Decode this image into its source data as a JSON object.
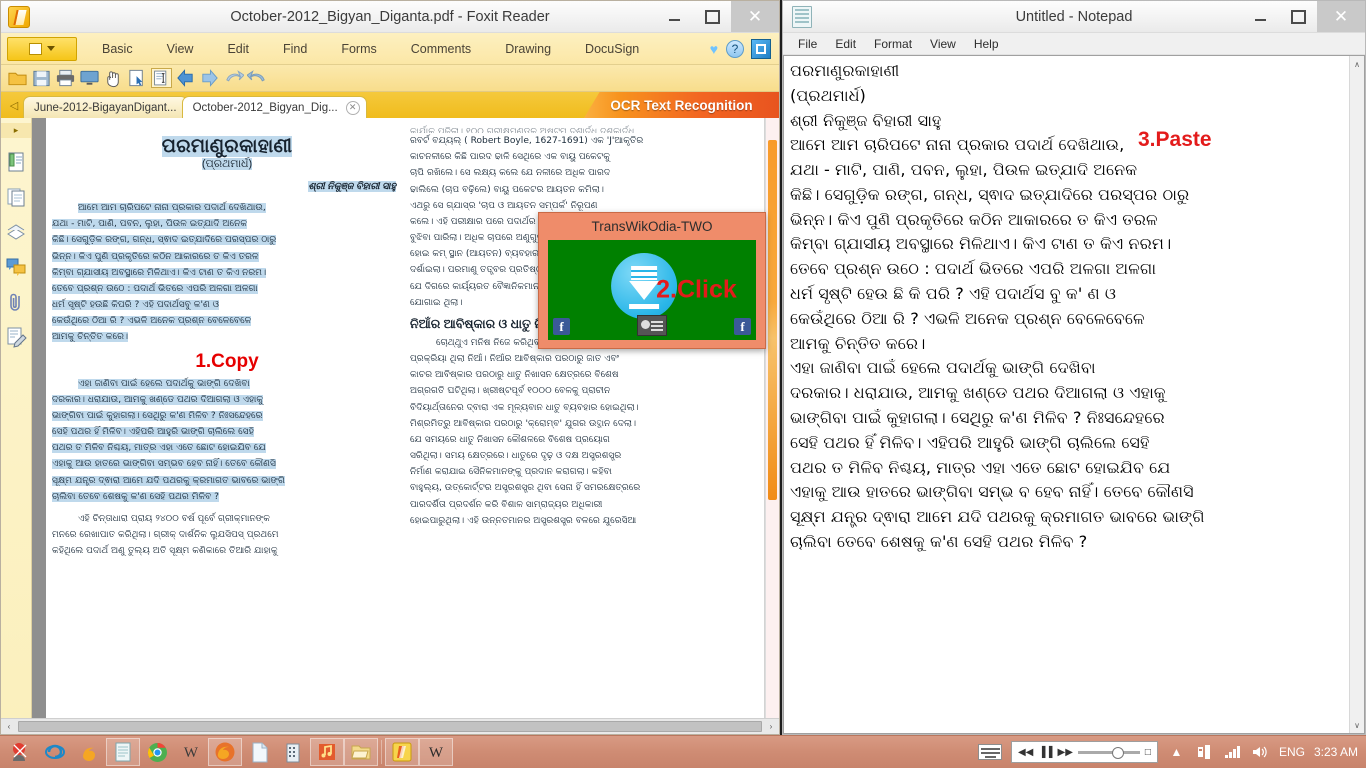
{
  "foxit": {
    "title": "October-2012_Bigyan_Diganta.pdf - Foxit Reader",
    "app_icon": "foxit-logo-icon",
    "window_buttons": {
      "minimize": "–",
      "maximize": "□",
      "close": "✕"
    },
    "file_button_label": "",
    "menus": [
      "Basic",
      "View",
      "Edit",
      "Find",
      "Forms",
      "Comments",
      "Drawing",
      "DocuSign"
    ],
    "heart": "♥",
    "help": "?",
    "toolbar_icons": [
      "open-folder-icon",
      "save-icon",
      "print-icon",
      "snapshot-icon",
      "hand-tool-icon",
      "select-object-icon",
      "text-select-icon",
      "previous-page-icon",
      "next-page-icon",
      "undo-icon",
      "redo-icon"
    ],
    "sidebar_icons": [
      "expand-panel-arrow-icon",
      "bookmarks-icon",
      "pages-thumbnail-icon",
      "layers-icon",
      "comments-icon",
      "attachments-icon",
      "signature-icon"
    ],
    "tabs": [
      {
        "label": "June-2012-BigayanDigant...",
        "active": false
      },
      {
        "label": "October-2012_Bigyan_Dig...",
        "active": true,
        "close": "✕"
      }
    ],
    "tab_nav": {
      "left": "◁",
      "right": "▷",
      "dropdown": "▼"
    },
    "ocr_button_label": "OCR Text Recognition",
    "copy_annotation": "1.Copy",
    "scroll": {
      "up": "∧",
      "down": "∨",
      "left": "‹",
      "right": "›"
    }
  },
  "pdf": {
    "title": "ପରମାଣୁରକାହାଣୀ",
    "subtitle": "(ପ୍ରଥମାର୍ଧ)",
    "author": "ଶ୍ରୀ ନିକୁଞ୍ଜ ବିହାରୀ ସାହୁ",
    "left_column_highlighted": [
      "ଆମେ ଆମ ଚାରିପଟେ ନାନା ପ୍ରକାର ପଦାର୍ଥ ଦେଖିଥାଉ,",
      "ଯଥା - ମାଟି, ପାଣି, ପବନ, ଲୁହା, ପିଉଳ ଇତ୍ଯାଦି ଅନେକ",
      "କିଛି। ସେଗୁଡ଼ିକ ରଙ୍ଗ, ଗନ୍ଧ, ସ୍ଵାଦ ଇତ୍ଯାଦିରେ ପରସ୍ପର ଠାରୁ",
      "ଭିନ୍ନ। କିଏ ପୁଣି ପ୍ରକୃତିରେ କଠିନ ଆକାରରେ ତ କିଏ ତରଳ",
      "କିମ୍ବା ଗ୍ଯାସୀୟ ଅବସ୍ଥାରେ ମିଳିଥାଏ। କିଏ ଟାଣ ତ କିଏ ନରମ।",
      "ତେବେ ପ୍ରଶ୍ନ ଉଠେ : ପଦାର୍ଥ ଭିତରେ ଏପରି ଅଳଗା ଅଳଗା",
      "ଧର୍ମ ସୃଷ୍ଟି ହଉଛି କିପରି ? ଏହି ପଦାର୍ଥସବୁ କ'ଣ ଓ",
      "କେଉଁଥିରେ ଠିଆ ରି ? ଏଭଳି ଅନେକ ପ୍ରଶ୍ନ ବେଳେବେଳେ",
      "ଆମକୁ ଚିନ୍ତିତ କରେ।"
    ],
    "left_column_block2": [
      "ଏହା ଜାଣିବା ପାଇଁ ହେଲେ ପଦାର୍ଥକୁ ଭାଙ୍ଗି ଦେଖିବା",
      "ଦରକାର। ଧରାଯାଉ, ଆମକୁ ଖଣ୍ଡେ ପଥର ଦିଆଗଲା ଓ ଏହାକୁ",
      "ଭାଙ୍ଗିବା ପାଇଁ କୁହାଗଲା। ସେଥିରୁ କ'ଣ ମିଳିବ ? ନିଃସନ୍ଦେହରେ",
      "ସେହି ପଥର ହିଁ ମିଳିବ। ଏହିପରି ଆହୁରି ଭାଙ୍ଗି ଚାଲିଲେ ସେହି",
      "ପଥର ତ ମିଳିବ ନିଶ୍ଚୟ, ମାତ୍ର ଏହା ଏତେ ଛୋଟ ହୋଇଯିବ ଯେ",
      "ଏହାକୁ ଆଉ ହାତରେ ଭାଙ୍ଗିବା ସମ୍ଭବ ହେବ ନାହିଁ। ତେବେ କୌଣସି",
      "ସୂକ୍ଷ୍ମ ଯନ୍ତ୍ର ଦ୍ଵାରା ଆମେ ଯଦି ପଥରକୁ କ୍ରମାଗତ ଭାବରେ ଭାଙ୍ଗି",
      "ଚାଲିବା ତେବେ ଶେଷକୁ କ'ଣ ସେହି ପଥର ମିଳିବ ?"
    ],
    "left_column_block3": [
      "ଏହି ଚିନ୍ତାଧାରା ପ୍ରାୟ ୨୪୦୦ ବର୍ଷ ପୂର୍ବେ ଗ୍ରୀକ୍ମାନଙ୍କ",
      "ମନରେ ରେଖାପାତ କରିଥିଲା। ଗ୍ରୀକ୍ ଦାର୍ଶନିକ ଲ୍ଯୁସିପସ୍ ପ୍ରଥମେ",
      "କହିଥିଲେ ପଦାର୍ଥ ଅଣୁ ତୁଲ୍ୟ ଅତି ସୂକ୍ଷ୍ମ କଣିକାରେ ତିଆରି ଯାହାକୁ"
    ],
    "right_column": [
      "ରବର୍ଟ ବଯ୍ୟଲ୍ ( Robert Boyle, 1627-1691) ଏକ 'J'ଆକୃତିର",
      "କାଚନଳୀରେ କିଛି ପାରଦ ଢାଳି ସେଥିରେ ଏକ ବାୟୁ ପକେଟକୁ",
      "ଚାପି ରଖିଲେ। ସେ ଲକ୍ଷ୍ୟ କଲେ ଯେ ନଳୀରେ ଅଧିକ ପାରଦ",
      "ଢାଲିଲେ (ଚାପ ବଢ଼ିଲେ) ବାୟୁ ପକେଟର ଆୟତନ କମିଲା।",
      "ଏଥରୁ ସେ ଗ୍ଯାସ୍ର 'ଚାପ ଓ ଆୟତନ ସମ୍ପର୍କ' ନିରୂପଣ",
      "କଲେ। ଏହି ପରୀକ୍ଷାର ପରେ ପଦାର୍ଥର ଅଣୁ ଧାରଣାକୁ",
      "ବୁଝିବା ପାରିଲା। ଅଧିକ ଚାପରେ ଅଣୁଗୁଡ଼ିକ ନିକଟ",
      "ହୋଇ କମ୍ ସ୍ଥାନ (ଆୟତନ) ବ୍ୟବହାର କରୁଥିବା",
      "ଦର୍ଶାଇଲା। ପରମାଣୁ ତତ୍ତ୍ବର ପ୍ରତିଷ୍ଠା ଏହା",
      "ଯେ ଦିଗରେ କାର୍ୟ୍ୟରତ ବୈଜ୍ଞାନିକମାନଙ୍କୁ ଯଥେଷ୍ଟ ପ୍ରେରଣା",
      "ଯୋଗାଇ ଥିଲା।"
    ],
    "right_heading": "ନିଆଁର ଆବିଷ୍କାର ଓ ଧାତୁ ନିଖାସନ",
    "right_column2": [
      "ଚୋଥ୍ଥୁଏ ମନିଷ ନିଜେ କରିଥିବା ସର୍ବପ୍ରଥମ ରାସାୟନିକ",
      "ପ୍ରକ୍ରିୟା ଥିଲା ନିଆଁ। ନିଆଁର ଆବିଷ୍କାର ପରଠାରୁ ଜାତ ଏବଂ",
      "କାଚର ଆବିଷ୍କାର ପରଠାରୁ ଧାତୁ ନିଖାସନ କ୍ଷେତ୍ରରେ ବିଶେଷ",
      "ଅଗ୍ରଗତି ଘଟିଥିଲା। ଖ୍ରୀଷ୍ଟପୂର୍ବ ୧୦୦୦ ବେଳକୁ ପ୍ରାଚୀନ",
      "ବିଦିୟାର୍ଥ୍ତାନେର ଦ୍ବାରା ଏକ ମୂଳ୍ୟବାନ ଧାତୁ ବ୍ୟବହାର ହୋଇଥିଲା।",
      "ମିଶ୍ରମିତ୍ରୁ ଆବିଷ୍କାର ପରଠାରୁ 'କ୍ରୋମ୍ବ' ଯୁଗର ଉତ୍ଥାନ ଦେଲା।",
      "ଯେ ସମୟରେ ଧାତୁ ନିଖାସନ କୌଶଳରେ ବିଶେଷ ପ୍ରୟୋଗ",
      "ସରିଥିଲା। ସମୟ କ୍ଷେତ୍ରରେ। ଧାତୁରେ ଦୃଢ଼ ଓ ଦକ୍ଷ ଅସ୍ତ୍ରଶସ୍ତ୍ର",
      "ନିର୍ମାଣ କରାଯାଇ ସୈନିକମାନଙ୍କୁ ପ୍ରଦାନ କରାଗଲା। କହିବା",
      "ବାହୁଲ୍ୟ, ଉତ୍କୋର୍ଟ୍ଟର ଅସ୍ତ୍ରଶସ୍ତ୍ର ଥିବା ସେନା ହିଁ ସମରକ୍ଷେତ୍ରରେ",
      "ପାରଦର୍ଶିତା ପ୍ରଦର୍ଶନ କରି ବିଶାଳ ସାମ୍ରାଜ୍ୟର ଅଧିକାରୀ",
      "ହୋଇପାରୁଥିଲା। ଏହି ଉନ୍ନତମାନର ଅସ୍ତ୍ରଶସ୍ତ୍ର ବଳରେ ଯୁରେସିଆ"
    ],
    "top_partial_line": "କାର୍ଯାକୁ ପଢ଼ିଲା। ୧୦୦ ଗ୍ରୀକ୍ଷମଣ୍ଡଳ ଅଷ୍ଟମ ଦଶାର୍ଦ୍ଧ ଦଶକାର୍ଦ୍ଧ"
  },
  "dialog": {
    "title": "TransWikOdia-TWO",
    "click_annotation": "2.Click",
    "download_icon": "download-arrow-icon",
    "fb_left_icon": "facebook-icon",
    "fb_right_icon": "facebook-icon",
    "contact_icon": "contact-card-icon"
  },
  "notepad": {
    "title": "Untitled - Notepad",
    "app_icon": "notepad-icon",
    "window_buttons": {
      "minimize": "–",
      "maximize": "□",
      "close": "✕"
    },
    "menus": [
      "File",
      "Edit",
      "Format",
      "View",
      "Help"
    ],
    "paste_annotation": "3.Paste",
    "scroll": {
      "up": "∧",
      "down": "∨"
    },
    "lines": [
      "ପରମାଣୁରକାହାଣୀ",
      "(ପ୍ରଥମାର୍ଧ)",
      "ଶ୍ରୀ ନିକୁଞ୍ଜ ବିହାରୀ ସାହୁ",
      "ଆମେ ଆମ ଚାରିପଟେ ନାନା ପ୍ରକାର ପଦାର୍ଥ ଦେଖିଥାଉ,",
      "ଯଥା - ମାଟି, ପାଣି, ପବନ, ଲୁହା, ପିଉଳ ଇତ୍ଯାଦି ଅନେକ",
      "କିଛି। ସେଗୁଡ଼ିକ ରଙ୍ଗ, ଗନ୍ଧ, ସ୍ଵାଦ ଇତ୍ଯାଦିରେ ପରସ୍ପର ଠାରୁ",
      "ଭିନ୍ନ। କିଏ ପୁଣି ପ୍ରକୃତିରେ କଠିନ ଆକାରରେ ତ କିଏ ତରଳ",
      "କିମ୍ବା ଗ୍ଯାସୀୟ ଅବସ୍ଥାରେ ମିଳିଥାଏ। କିଏ ଟାଣ ତ କିଏ ନରମ।",
      "ତେବେ ପ୍ରଶ୍ନ ଉଠେ : ପଦାର୍ଥ ଭିତରେ ଏପରି ଅଳଗା ଅଳଗା",
      "ଧର୍ମ ସୃଷ୍ଟି  ହେଉ ଛି କି ପରି ? ଏହି ପଦାର୍ଥସ ବୁ କ' ଣ ଓ",
      "କେଉଁଥିରେ ଠିଆ ରି ? ଏଭଳି ଅନେକ ପ୍ରଶ୍ନ ବେଳେବେଳେ",
      "ଆମକୁ ଚିନ୍ତିତ କରେ।",
      "ଏହା ଜାଣିବା ପାଇଁ ହେଲେ ପଦାର୍ଥକୁ ଭାଙ୍ଗି ଦେଖିବା",
      "ଦରକାର। ଧରାଯାଉ, ଆମକୁ ଖଣ୍ଡେ ପଥର ଦିଆଗଲା ଓ ଏହାକୁ",
      "ଭାଙ୍ଗିବା ପାଇଁ କୁହାଗଲା। ସେଥିରୁ କ'ଣ ମିଳିବ ? ନିଃସନ୍ଦେହରେ",
      "ସେହି ପଥର ହିଁ ମିଳିବ। ଏହିପରି ଆହୁରି ଭାଙ୍ଗି ଚାଲିଲେ ସେହି",
      "ପଥର ତ ମିଳିବ ନିଶ୍ଚୟ, ମାତ୍ର ଏହା ଏତେ ଛୋଟ ହୋଇଯିବ ଯେ",
      "ଏହାକୁ ଆଉ ହାତରେ ଭାଙ୍ଗିବା ସମ୍ଭ ବ ହେବ ନାହିଁ। ତେବେ କୌଣସି",
      "ସୂକ୍ଷ୍ମ ଯନ୍ତ୍ର ଦ୍ଵାରା ଆମେ ଯଦି ପଥରକୁ କ୍ରମାଗତ ଭାବରେ ଭାଙ୍ଗି",
      "ଚାଲିବା ତେବେ ଶେଷକୁ କ'ଣ ସେହି ପଥର ମିଳିବ ?"
    ]
  },
  "taskbar": {
    "start_icon": "start-button-icon",
    "items": [
      {
        "icon": "internet-explorer-icon",
        "boxed": false
      },
      {
        "icon": "firefox-small-icon",
        "boxed": false
      },
      {
        "icon": "notepad-taskbar-icon",
        "boxed": true
      },
      {
        "icon": "chrome-icon",
        "boxed": false
      },
      {
        "icon": "wikipedia-icon",
        "boxed": false
      },
      {
        "icon": "firefox-icon",
        "boxed": true
      },
      {
        "icon": "document-icon",
        "boxed": false
      },
      {
        "icon": "building-icon",
        "boxed": false
      },
      {
        "icon": "music-icon",
        "boxed": true
      },
      {
        "icon": "folder-icon",
        "boxed": true
      },
      {
        "icon": "foxit-reader-icon",
        "boxed": true
      },
      {
        "icon": "wikipedia-active-icon",
        "boxed": true
      }
    ],
    "tray": {
      "keyboard_icon": "keyboard-icon",
      "media": {
        "prev": "◀◀",
        "pause": "▐▐",
        "next": "▶▶"
      },
      "chevron": "▲",
      "network_icon": "network-icon",
      "signal_icon": "signal-bars-icon",
      "volume_icon": "volume-icon",
      "language": "ENG",
      "clock": "3:23 AM"
    }
  }
}
